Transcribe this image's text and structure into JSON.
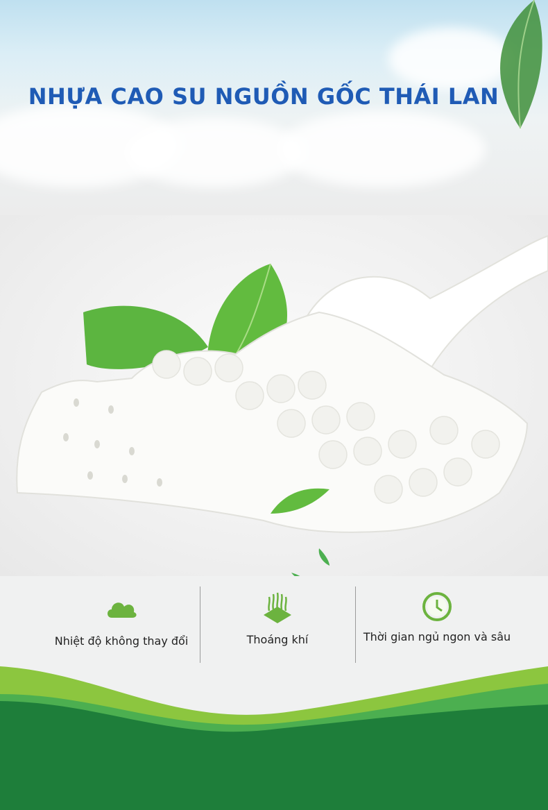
{
  "title": "NHỰA CAO SU NGUỒN GỐC THÁI LAN",
  "features": [
    {
      "label": "Nhiệt độ không thay đổi",
      "icon": "cloud-icon"
    },
    {
      "label": "Thoáng khí",
      "icon": "airflow-icon"
    },
    {
      "label": "Thời gian ngủ ngon và sâu",
      "icon": "clock-icon"
    }
  ],
  "colors": {
    "title": "#1f5bb5",
    "green_light": "#8cc63f",
    "green_dark": "#1e7e3a",
    "leaf": "#4caf50"
  }
}
